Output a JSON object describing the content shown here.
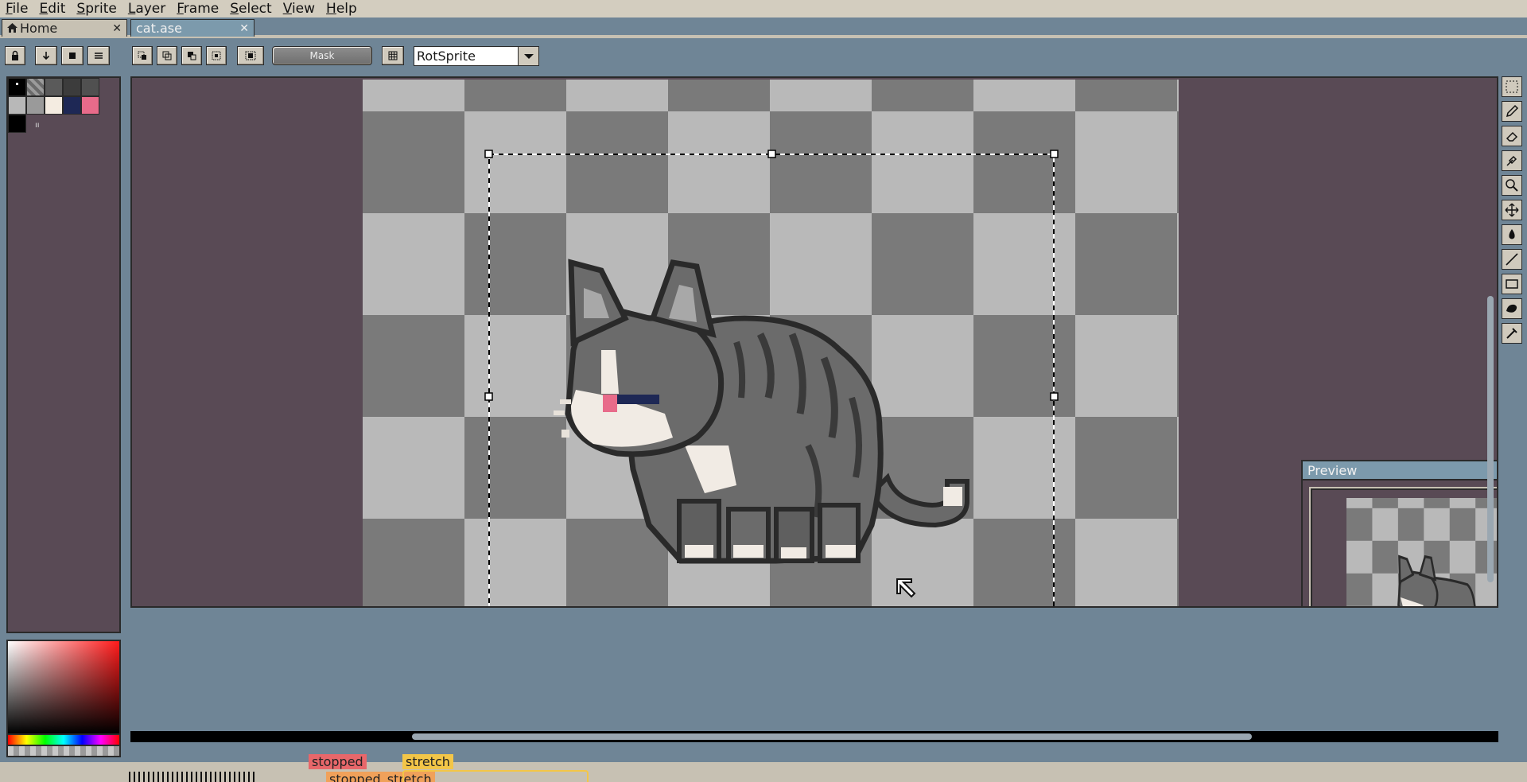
{
  "menu": [
    "File",
    "Edit",
    "Sprite",
    "Layer",
    "Frame",
    "Select",
    "View",
    "Help"
  ],
  "tabs": [
    {
      "label": "Home",
      "icon": "home-icon"
    },
    {
      "label": "cat.ase"
    }
  ],
  "toolbar": {
    "mask_label": "Mask",
    "algorithm": "RotSprite"
  },
  "palette": [
    "#000000",
    "#7a7a7a",
    "#5a5a5a",
    "#3c3c3c",
    "#b8b8b8",
    "#9a9a9a",
    "#f4ece1",
    "#1e2855",
    "#e86b8a",
    "#000000"
  ],
  "preview": {
    "title": "Preview"
  },
  "statusbar": {
    "tag_stopped": "stopped",
    "tag_stretch": "stretch",
    "tag_stopped_stretch": "stopped_stretch"
  },
  "colors": {
    "accent": "#7c9aac",
    "panel": "#594a55",
    "checker_light": "#b9b9b9",
    "checker_dark": "#7a7a7a"
  }
}
